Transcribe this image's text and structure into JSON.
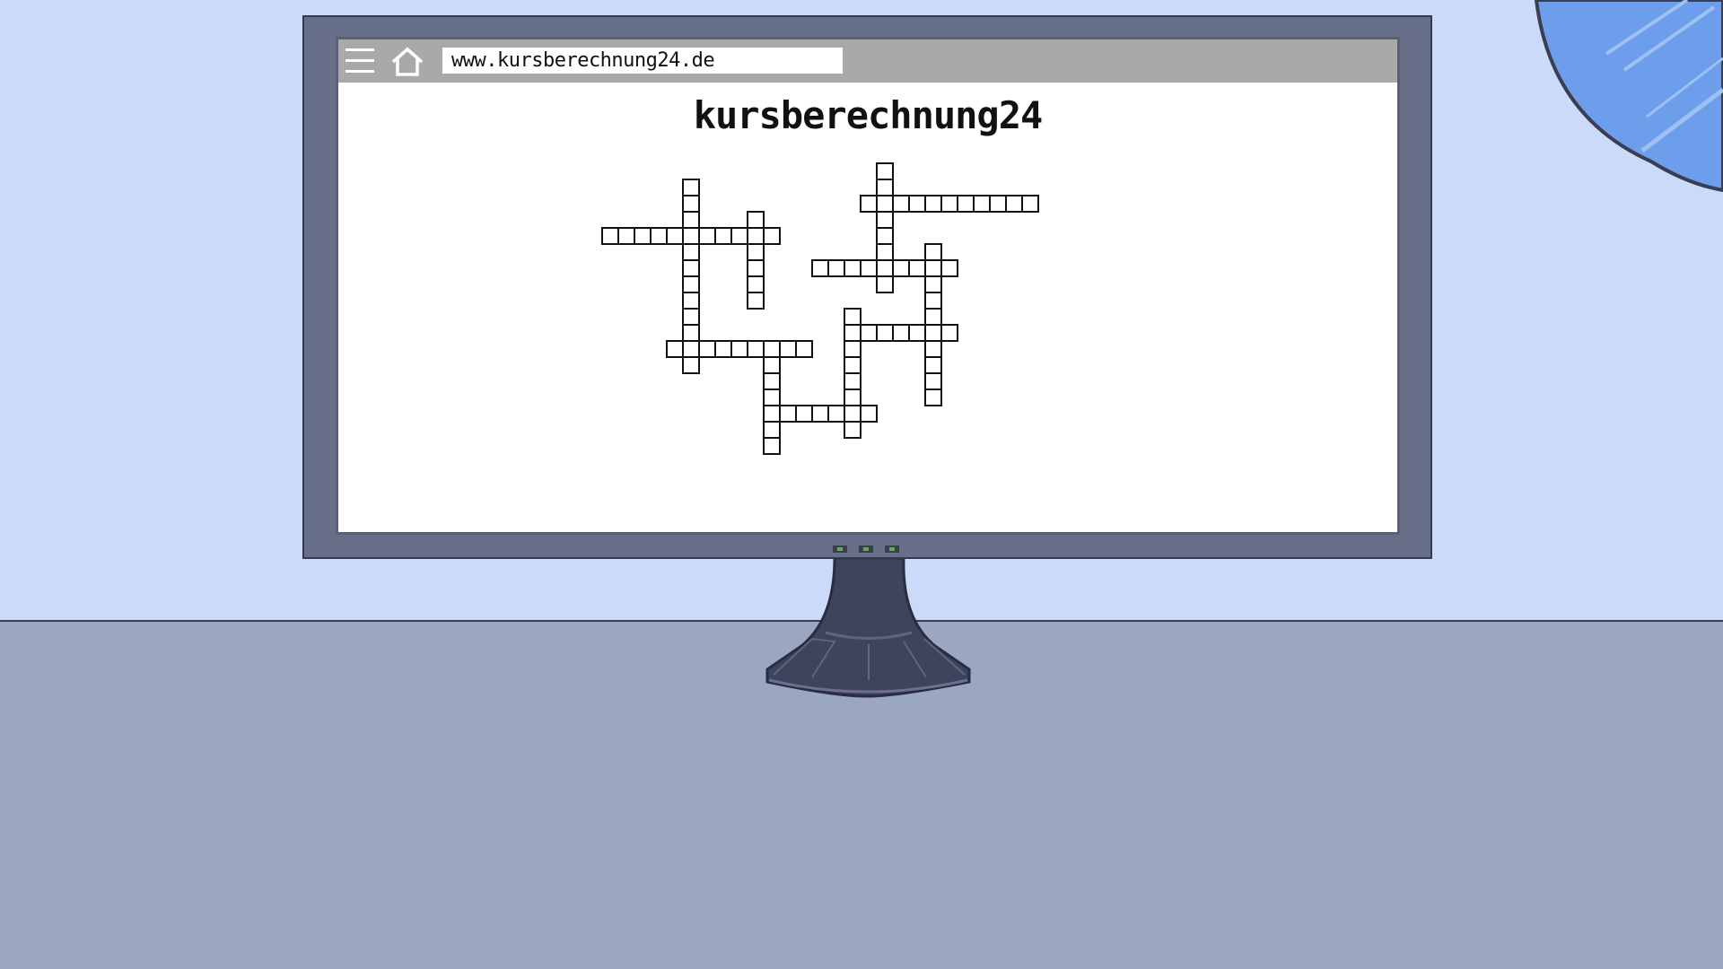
{
  "browser": {
    "url": "www.kursberechnung24.de",
    "menu_icon": "hamburger-menu-icon",
    "home_icon": "home-icon"
  },
  "page": {
    "title": "kursberechnung24"
  },
  "crossword": {
    "words": [
      {
        "orientation": "vertical",
        "row": 0,
        "col": 5,
        "length": 12
      },
      {
        "orientation": "horizontal",
        "row": 3,
        "col": 0,
        "length": 11
      },
      {
        "orientation": "vertical",
        "row": 2,
        "col": 9,
        "length": 6
      },
      {
        "orientation": "horizontal",
        "row": 10,
        "col": 4,
        "length": 9
      },
      {
        "orientation": "vertical",
        "row": 10,
        "col": 10,
        "length": 7
      },
      {
        "orientation": "horizontal",
        "row": 14,
        "col": 10,
        "length": 7
      },
      {
        "orientation": "vertical",
        "row": 8,
        "col": 15,
        "length": 8
      },
      {
        "orientation": "horizontal",
        "row": 9,
        "col": 15,
        "length": 7
      },
      {
        "orientation": "vertical",
        "row": 4,
        "col": 20,
        "length": 10
      },
      {
        "orientation": "horizontal",
        "row": 5,
        "col": 13,
        "length": 9
      },
      {
        "orientation": "vertical",
        "row": -1,
        "col": 17,
        "length": 8
      },
      {
        "orientation": "horizontal",
        "row": 1,
        "col": 16,
        "length": 11
      }
    ]
  },
  "colors": {
    "wall": "#cbdaf9",
    "desk": "#9aa6c2",
    "monitor_frame": "#687089",
    "toolbar": "#a9a9a9",
    "lamp": "#6d9eeb"
  }
}
